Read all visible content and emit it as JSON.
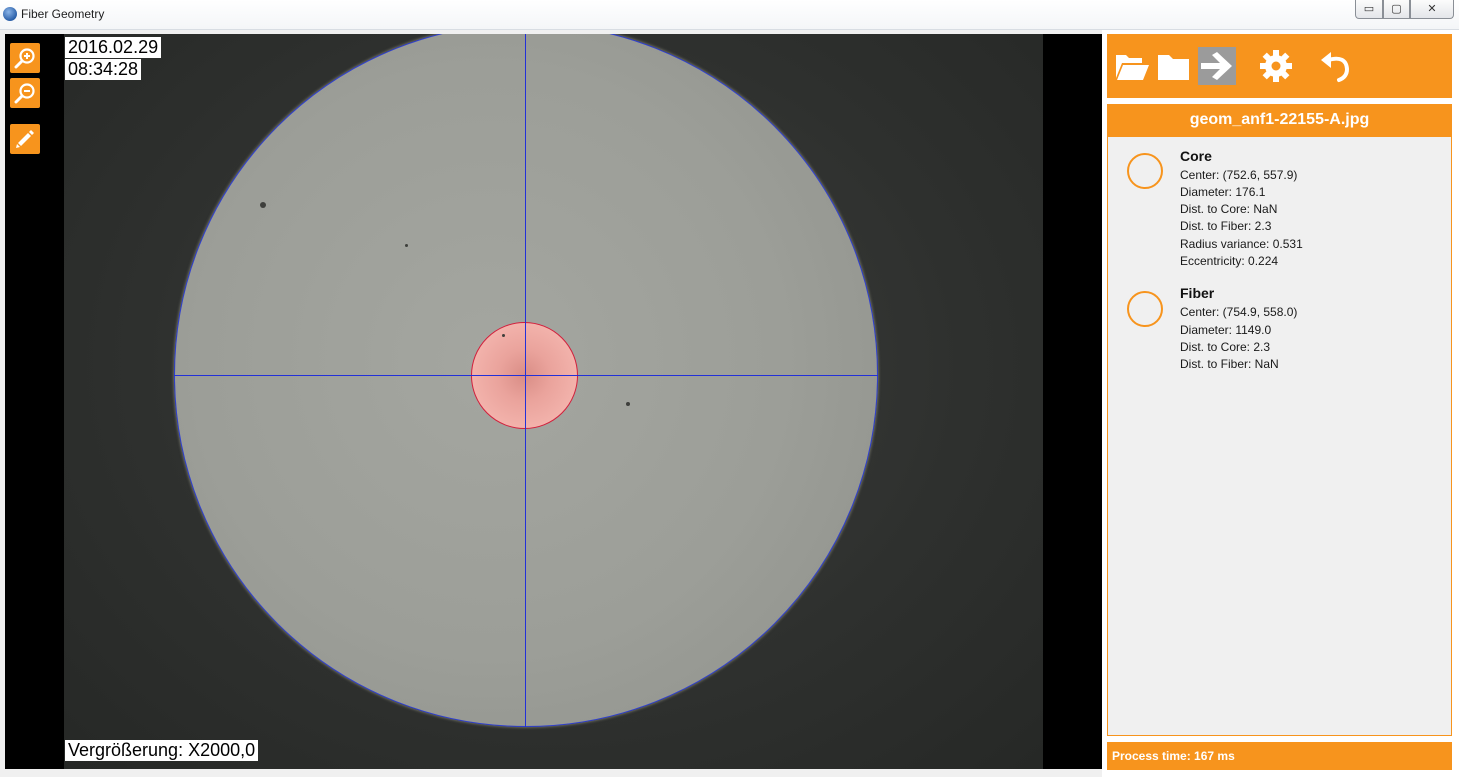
{
  "window": {
    "title": "Fiber Geometry",
    "controls": {
      "minimize": "▭",
      "maximize": "▢",
      "close": "✕"
    }
  },
  "viewer": {
    "date": "2016.02.29",
    "time": "08:34:28",
    "magnification": "Vergrößerung: X2000,0",
    "tools": [
      {
        "name": "zoom-in-icon"
      },
      {
        "name": "zoom-out-icon"
      },
      {
        "name": "pencil-icon"
      }
    ],
    "colors": {
      "crosshair": "#2330d8",
      "core_outline": "#d21f3c",
      "fiber_outline": "#3040d0"
    }
  },
  "panel": {
    "toolbar": [
      {
        "name": "open-folder-icon"
      },
      {
        "name": "folder-icon"
      },
      {
        "name": "arrow-right-icon",
        "active": true
      },
      {
        "name": "gear-icon"
      },
      {
        "name": "undo-icon"
      }
    ],
    "filename": "geom_anf1-22155-A.jpg",
    "results": [
      {
        "title": "Core",
        "lines": [
          "Center: (752.6, 557.9)",
          "Diameter: 176.1",
          "Dist. to Core: NaN",
          "Dist. to Fiber: 2.3",
          "Radius variance: 0.531",
          "Eccentricity: 0.224"
        ]
      },
      {
        "title": "Fiber",
        "lines": [
          "Center: (754.9, 558.0)",
          "Diameter: 1149.0",
          "Dist. to Core: 2.3",
          "Dist. to Fiber: NaN"
        ]
      }
    ],
    "status": "Process time: 167 ms",
    "accent_color": "#f7941d"
  }
}
